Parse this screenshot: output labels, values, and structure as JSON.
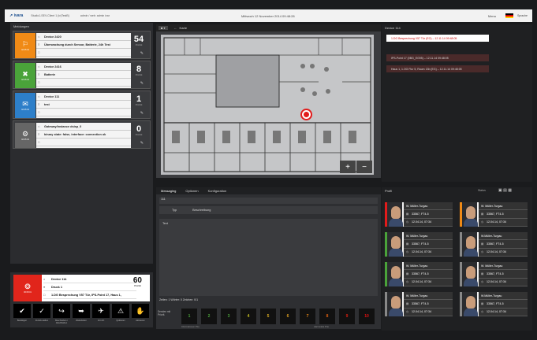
{
  "topbar": {
    "logo": "↗ ivara",
    "host": "Studio1-SEV-Client 1 (iv)TestB)",
    "user": "admin / web: admin ivar",
    "date": "Mittwoch 12 November 2014 09:48:28",
    "menu": "Menu",
    "lang": "Sprache"
  },
  "left": {
    "title": "Meldungen",
    "notifications": [
      {
        "color": "#f08a16",
        "icon": "⚐",
        "tag": "02:25:04",
        "device": "Device 2420",
        "message": "Überwachung durch Sensor, Batterie, 24h Test",
        "count": "54",
        "prio": "Priorität"
      },
      {
        "color": "#4aa33a",
        "icon": "✖",
        "tag": "02:25:04",
        "device": "Device 2416",
        "message": "Batterie",
        "count": "8",
        "prio": "Priorität"
      },
      {
        "color": "#2d7fc9",
        "icon": "✉",
        "tag": "02:25:04",
        "device": "Device 111",
        "message": "test",
        "count": "1",
        "prio": "Priorität"
      },
      {
        "color": "#666666",
        "icon": "⚙",
        "tag": "02:25:04",
        "device": "Gateway/instance dsisp_0",
        "message": "binary state: false, interface: connection ok",
        "count": "0",
        "prio": "Priorität"
      }
    ]
  },
  "alarm": {
    "device": "Device 114",
    "sub": "Druck 1",
    "message": "1.DG Besprechung V57 Tür, IPS-Point 17, Haus 1,",
    "count": "60",
    "prio": "Priorität",
    "tag": "06:08:01"
  },
  "actions": [
    {
      "icon": "✔",
      "label": "Bestätigen"
    },
    {
      "icon": "✓",
      "label": "Zurück-stellen"
    },
    {
      "icon": "↪",
      "label": "Beschreiben / Abschließen"
    },
    {
      "icon": "➥",
      "label": "Weiterleiten"
    },
    {
      "icon": "✈",
      "label": "Vor-Ort"
    },
    {
      "icon": "⚠",
      "label": "Quittieren"
    },
    {
      "icon": "✋",
      "label": "Aktivieren"
    }
  ],
  "map": {
    "tab": "Karte",
    "zoom_in": "+",
    "zoom_out": "−"
  },
  "messaging": {
    "tabs": [
      "Messaging",
      "Optionen",
      "Konfiguration"
    ],
    "to": "111",
    "type_label": "Typ",
    "desc_label": "Beschreibung",
    "text_label": "Text",
    "status": "Zeilen: 1   Wörter: 0   Zeichen: 0/1",
    "send_label": "Senden mit Priorit.",
    "levels": [
      "1",
      "2",
      "3",
      "4",
      "5",
      "6",
      "7",
      "8",
      "9",
      "10"
    ],
    "low": "Informationen Prio",
    "high": "Alarmstufe Prio"
  },
  "right": {
    "title": "Device 114",
    "items": [
      "1.DG Besprechung V57 Tür (EG) – 12.11.14 09:48:05",
      "IPS-Point 17 (0BG_EG95) – 12.11.14 09:48:05",
      "Haus 1, 1.OG Flur 5, Raum 13b (EG) – 12.11.14 09:48:05"
    ]
  },
  "persons": {
    "title": "Profil",
    "filter": "Status",
    "cards": [
      {
        "name": "W. Müller-Turgau",
        "id": "33567, FT4-5",
        "time": "12.04.14, 07:34",
        "border": "#e21b1b"
      },
      {
        "name": "W. Müller-Turgau",
        "id": "33567, FT4-5",
        "time": "12.04.14, 07:34",
        "border": "#f08a16"
      },
      {
        "name": "W. Müller-Turgau",
        "id": "33567, FT4-5",
        "time": "12.04.14, 07:34",
        "border": "#4aa33a"
      },
      {
        "name": "W.Müller-Turgau",
        "id": "33567, FT4-5",
        "time": "12.04.14, 07:34",
        "border": "#888888"
      },
      {
        "name": "W. Müller-Turgau",
        "id": "33567, FT4-5",
        "time": "12.04.14, 07:34",
        "border": "#4aa33a"
      },
      {
        "name": "W. Müller-Turgau",
        "id": "33567, FT4-5",
        "time": "12.04.14, 07:34",
        "border": "#888888"
      },
      {
        "name": "W. Müller-Turgau",
        "id": "33567, FT4-5",
        "time": "12.04.14, 07:34",
        "border": "#888888"
      },
      {
        "name": "W.Müller-Turgau",
        "id": "33567, FT4-5",
        "time": "12.04.14, 07:34",
        "border": "#888888"
      }
    ]
  }
}
